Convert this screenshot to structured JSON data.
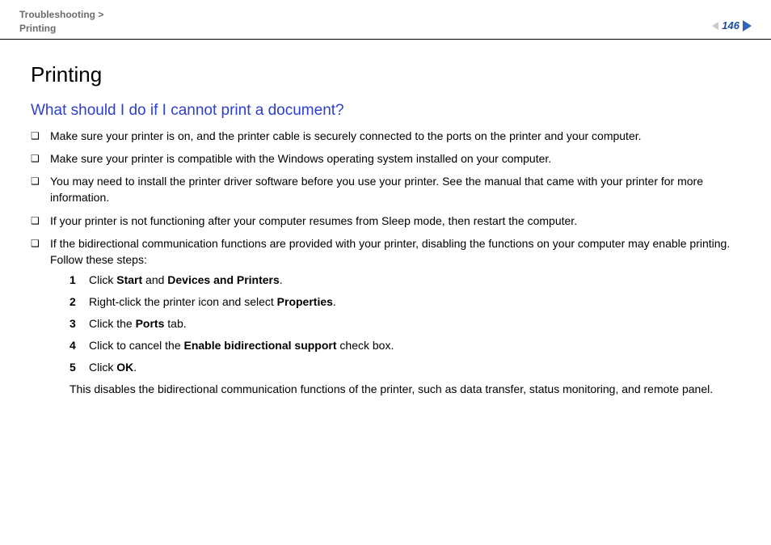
{
  "breadcrumb": {
    "parent": "Troubleshooting",
    "sep": ">",
    "current": "Printing"
  },
  "pageNumber": "146",
  "title": "Printing",
  "question": "What should I do if I cannot print a document?",
  "bullets": [
    {
      "text": "Make sure your printer is on, and the printer cable is securely connected to the ports on the printer and your computer."
    },
    {
      "text": "Make sure your printer is compatible with the Windows operating system installed on your computer."
    },
    {
      "text": "You may need to install the printer driver software before you use your printer. See the manual that came with your printer for more information."
    },
    {
      "text": "If your printer is not functioning after your computer resumes from Sleep mode, then restart the computer."
    },
    {
      "text": "If the bidirectional communication functions are provided with your printer, disabling the functions on your computer may enable printing. Follow these steps:"
    }
  ],
  "steps": [
    {
      "n": "1",
      "pre": "Click ",
      "b1": "Start",
      "mid": " and ",
      "b2": "Devices and Printers",
      "post": "."
    },
    {
      "n": "2",
      "pre": "Right-click the printer icon and select ",
      "b1": "Properties",
      "mid": "",
      "b2": "",
      "post": "."
    },
    {
      "n": "3",
      "pre": "Click the ",
      "b1": "Ports",
      "mid": "",
      "b2": "",
      "post": " tab."
    },
    {
      "n": "4",
      "pre": "Click to cancel the ",
      "b1": "Enable bidirectional support",
      "mid": "",
      "b2": "",
      "post": " check box."
    },
    {
      "n": "5",
      "pre": "Click ",
      "b1": "OK",
      "mid": "",
      "b2": "",
      "post": "."
    }
  ],
  "afterSteps": "This disables the bidirectional communication functions of the printer, such as data transfer, status monitoring, and remote panel."
}
